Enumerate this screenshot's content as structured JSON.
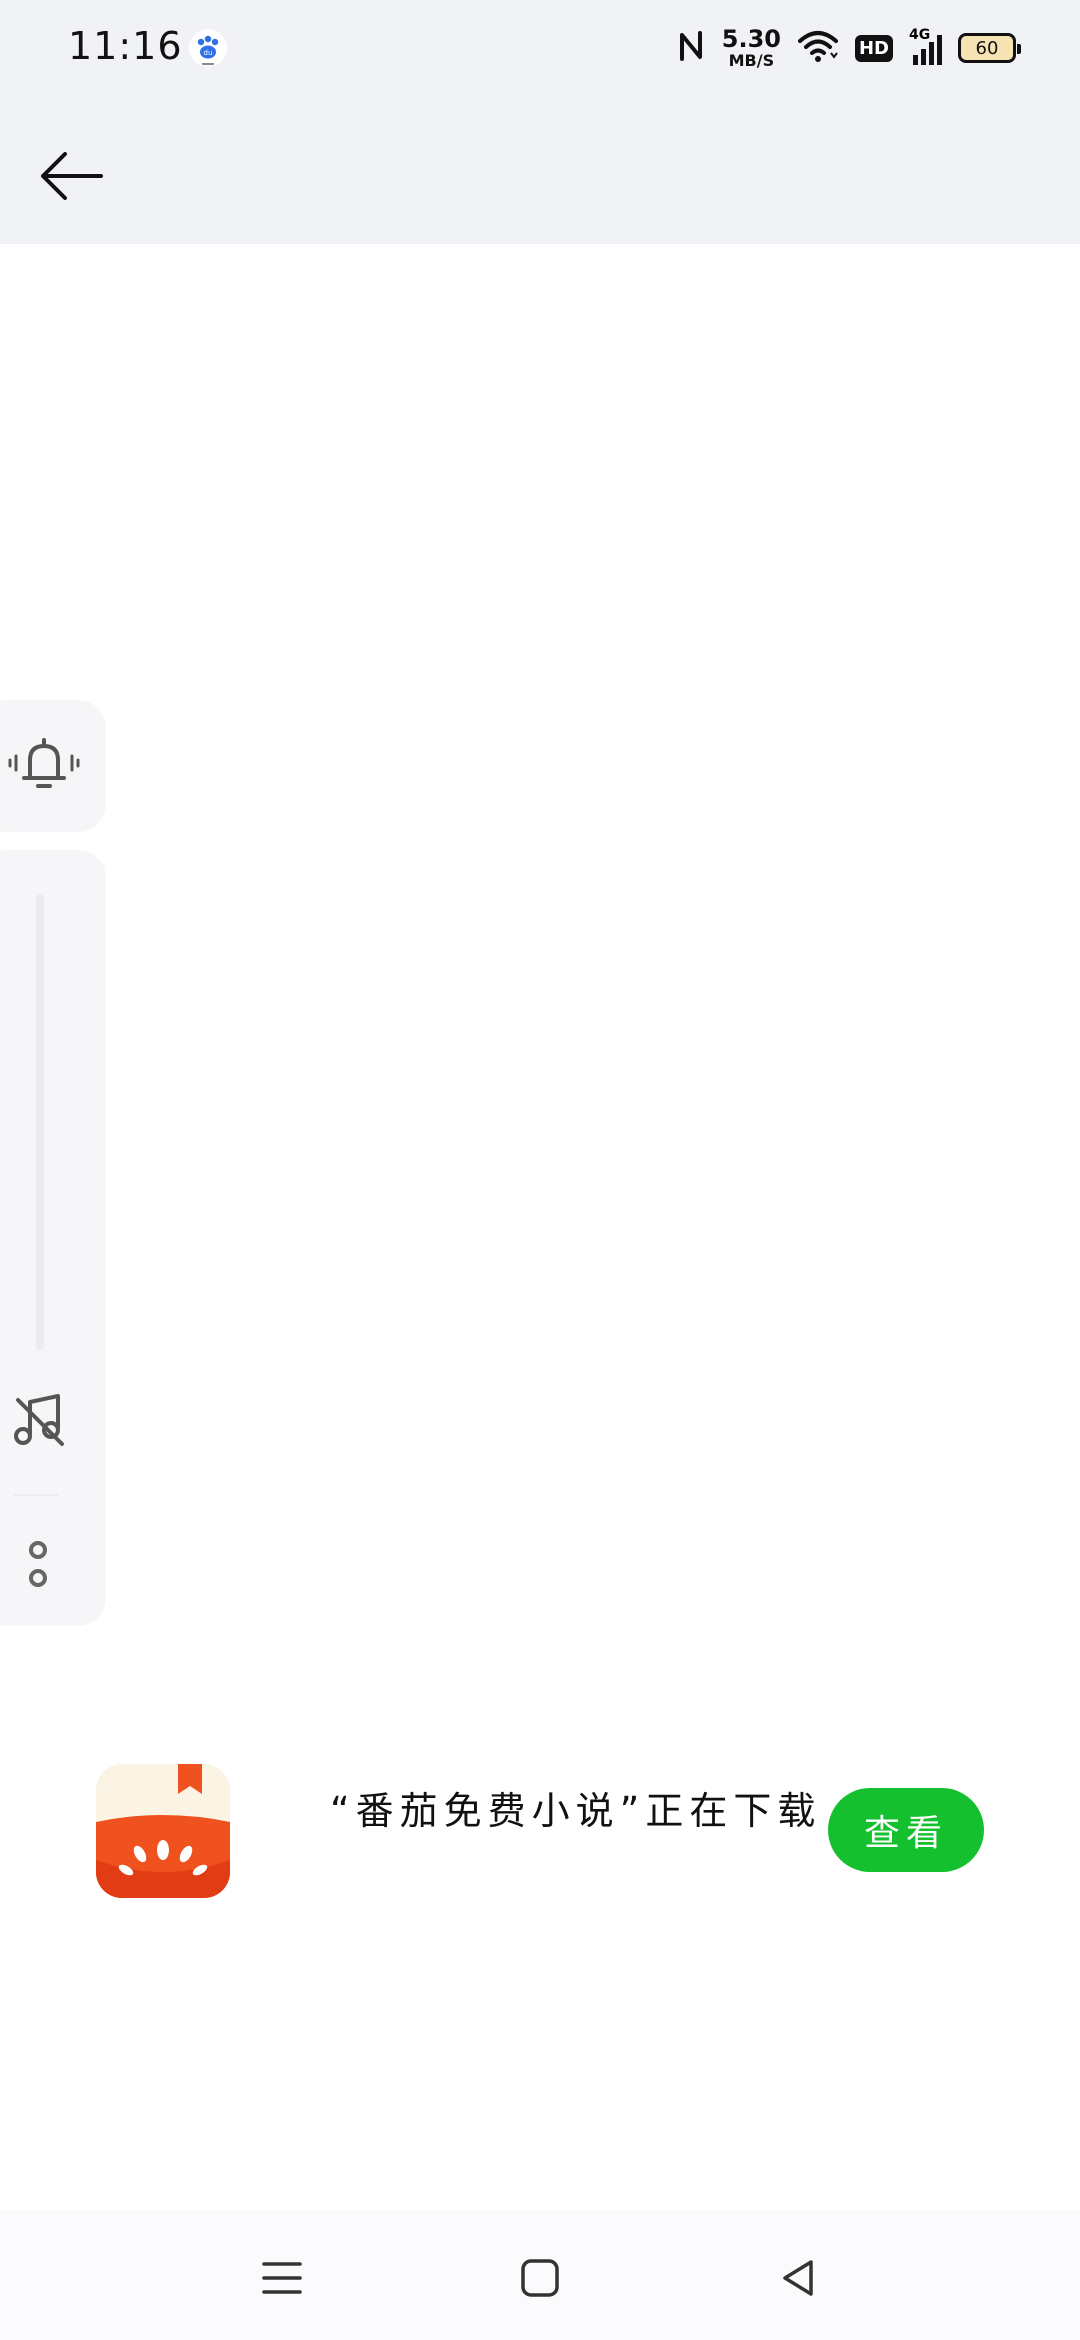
{
  "status_bar": {
    "time": "11:16",
    "net_speed_value": "5.30",
    "net_speed_unit": "MB/S",
    "hd_label": "HD",
    "signal_label": "4G",
    "battery_level": "60",
    "icons": [
      "baidu-app-icon",
      "nfc-icon",
      "wifi-icon",
      "hd-icon",
      "signal-icon",
      "battery-icon"
    ]
  },
  "header": {
    "back_icon": "arrow-left-icon"
  },
  "side_panel": {
    "icons": [
      "bell-icon",
      "music-off-icon",
      "more-dots-icon"
    ]
  },
  "download": {
    "message": "“番茄免费小说”正在下载",
    "view_button": "查看",
    "app_icon": "tomato-novel-app-icon",
    "accent": "#15c02f"
  },
  "nav_bar": {
    "icons": [
      "menu-icon",
      "home-icon",
      "back-triangle-icon"
    ]
  }
}
